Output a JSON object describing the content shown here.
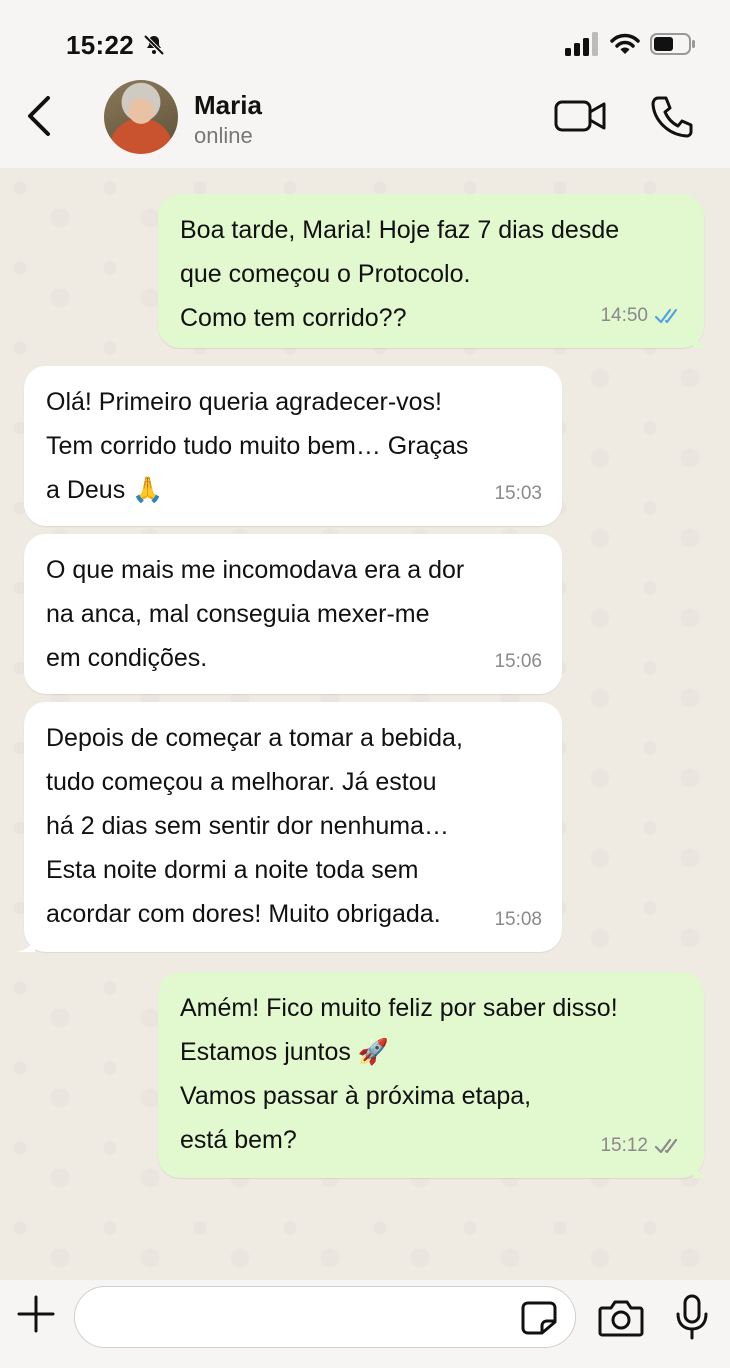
{
  "status_bar": {
    "time": "15:22"
  },
  "header": {
    "contact_name": "Maria",
    "contact_status": "online"
  },
  "messages": [
    {
      "direction": "outgoing",
      "lines": [
        "Boa tarde, Maria! Hoje faz 7 dias desde",
        "que começou o Protocolo.",
        "Como tem corrido??"
      ],
      "time": "14:50",
      "status": "read"
    },
    {
      "direction": "incoming",
      "lines": [
        "Olá! Primeiro queria agradecer-vos!",
        "Tem corrido tudo muito bem… Graças",
        "a Deus 🙏"
      ],
      "time": "15:03"
    },
    {
      "direction": "incoming",
      "lines": [
        "O que mais me incomodava era a dor",
        "na anca, mal conseguia mexer-me",
        "em condições."
      ],
      "time": "15:06"
    },
    {
      "direction": "incoming",
      "lines": [
        "Depois de começar a tomar a bebida,",
        "tudo começou a melhorar. Já estou",
        "há 2 dias sem sentir dor nenhuma…",
        "Esta noite dormi a noite toda sem",
        "acordar com dores! Muito obrigada."
      ],
      "time": "15:08"
    },
    {
      "direction": "outgoing",
      "lines": [
        "Amém! Fico muito feliz por saber disso!",
        "Estamos juntos 🚀",
        "Vamos passar à próxima etapa,",
        "está bem?"
      ],
      "time": "15:12",
      "status": "delivered"
    }
  ],
  "colors": {
    "outgoing_bubble": "#e2f8cf",
    "incoming_bubble": "#ffffff",
    "read_tick": "#4fa3e0",
    "delivered_tick": "#8a8a8a"
  },
  "icons": [
    "bell-slash-icon",
    "signal-icon",
    "wifi-icon",
    "battery-icon",
    "back-arrow-icon",
    "video-call-icon",
    "phone-icon",
    "double-tick-icon",
    "plus-icon",
    "sticker-icon",
    "camera-icon",
    "microphone-icon"
  ],
  "input": {
    "value": "",
    "placeholder": ""
  }
}
